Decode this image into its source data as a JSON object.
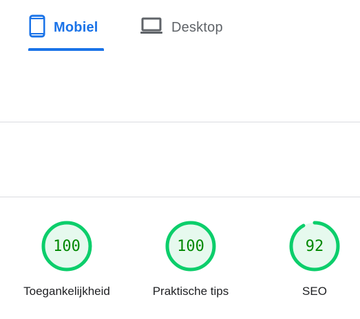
{
  "tabs": {
    "mobile": {
      "label": "Mobiel",
      "icon": "smartphone-icon",
      "selected": true
    },
    "desktop": {
      "label": "Desktop",
      "icon": "laptop-icon",
      "selected": false
    }
  },
  "scores": [
    {
      "label": "Toegankelijkheid",
      "value": "100",
      "score": 100
    },
    {
      "label": "Praktische tips",
      "value": "100",
      "score": 100
    },
    {
      "label": "SEO",
      "value": "92",
      "score": 92
    }
  ],
  "colors": {
    "accent": "#1a73e8",
    "tab_inactive": "#5f6368",
    "score_good": "#0cce6b",
    "score_good_fill": "#e6f9ee",
    "score_good_text": "#008800",
    "divider": "#dadce0"
  }
}
